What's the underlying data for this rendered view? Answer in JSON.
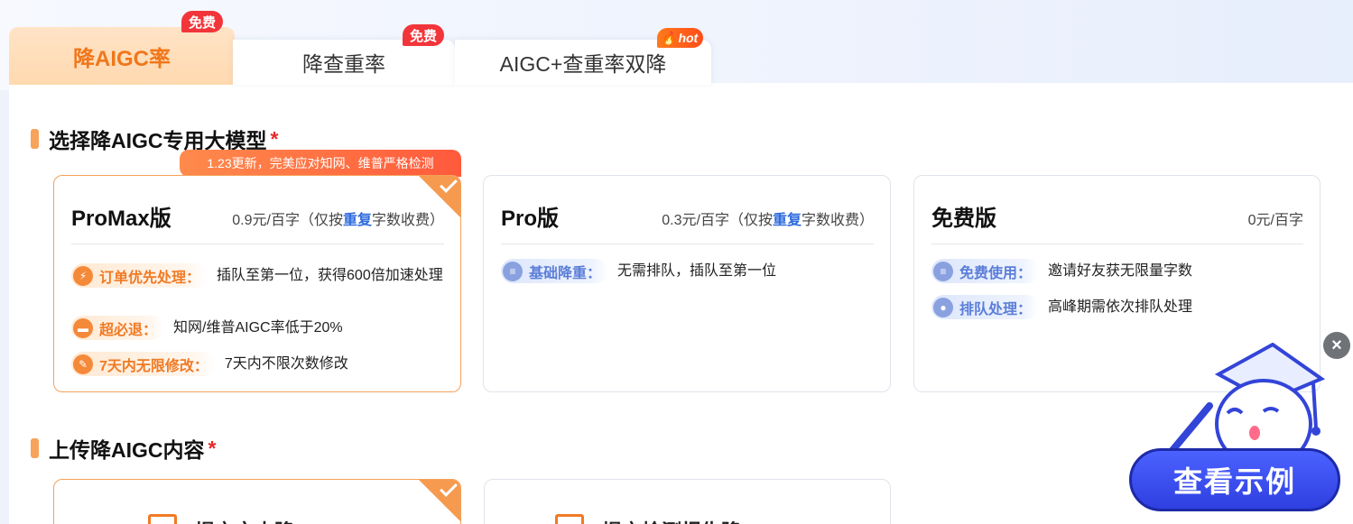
{
  "tabs": [
    {
      "label": "降AIGC率",
      "badge": "免费"
    },
    {
      "label": "降查重率",
      "badge": "免费"
    },
    {
      "label": "AIGC+查重率双降",
      "badge": "hot"
    }
  ],
  "section1": {
    "title": "选择降AIGC专用大模型",
    "required": "*"
  },
  "promo": "1.23更新，完美应对知网、维普严格检测",
  "cards": [
    {
      "name": "ProMax版",
      "price_prefix": "0.9元/百字（仅按",
      "price_highlight": "重复",
      "price_suffix": "字数收费）",
      "features": [
        {
          "label": "订单优先处理：",
          "icon": "lightning-icon",
          "text": "插队至第一位，获得600倍加速处理"
        },
        {
          "label": "超必退：",
          "icon": "wallet-icon",
          "text": "知网/维普AIGC率低于20%"
        },
        {
          "label": "7天内无限修改：",
          "icon": "edit-icon",
          "text": "7天内不限次数修改"
        }
      ]
    },
    {
      "name": "Pro版",
      "price_prefix": "0.3元/百字（仅按",
      "price_highlight": "重复",
      "price_suffix": "字数收费）",
      "features": [
        {
          "label": "基础降重：",
          "icon": "layers-icon",
          "text": "无需排队，插队至第一位"
        }
      ]
    },
    {
      "name": "免费版",
      "price_prefix": "0元/百字",
      "features": [
        {
          "label": "免费使用：",
          "icon": "layers-icon",
          "text": "邀请好友获无限量字数"
        },
        {
          "label": "排队处理：",
          "icon": "user-icon",
          "text": "高峰期需依次排队处理"
        }
      ]
    }
  ],
  "section2": {
    "title": "上传降AIGC内容",
    "required": "*"
  },
  "upload_options": [
    {
      "label": "提交文本降"
    },
    {
      "label": "提交检测报告降"
    }
  ],
  "example_button": "查看示例",
  "colors": {
    "accent": "#f07a24",
    "blue": "#2e6bdc",
    "button": "#3b4cf0"
  }
}
